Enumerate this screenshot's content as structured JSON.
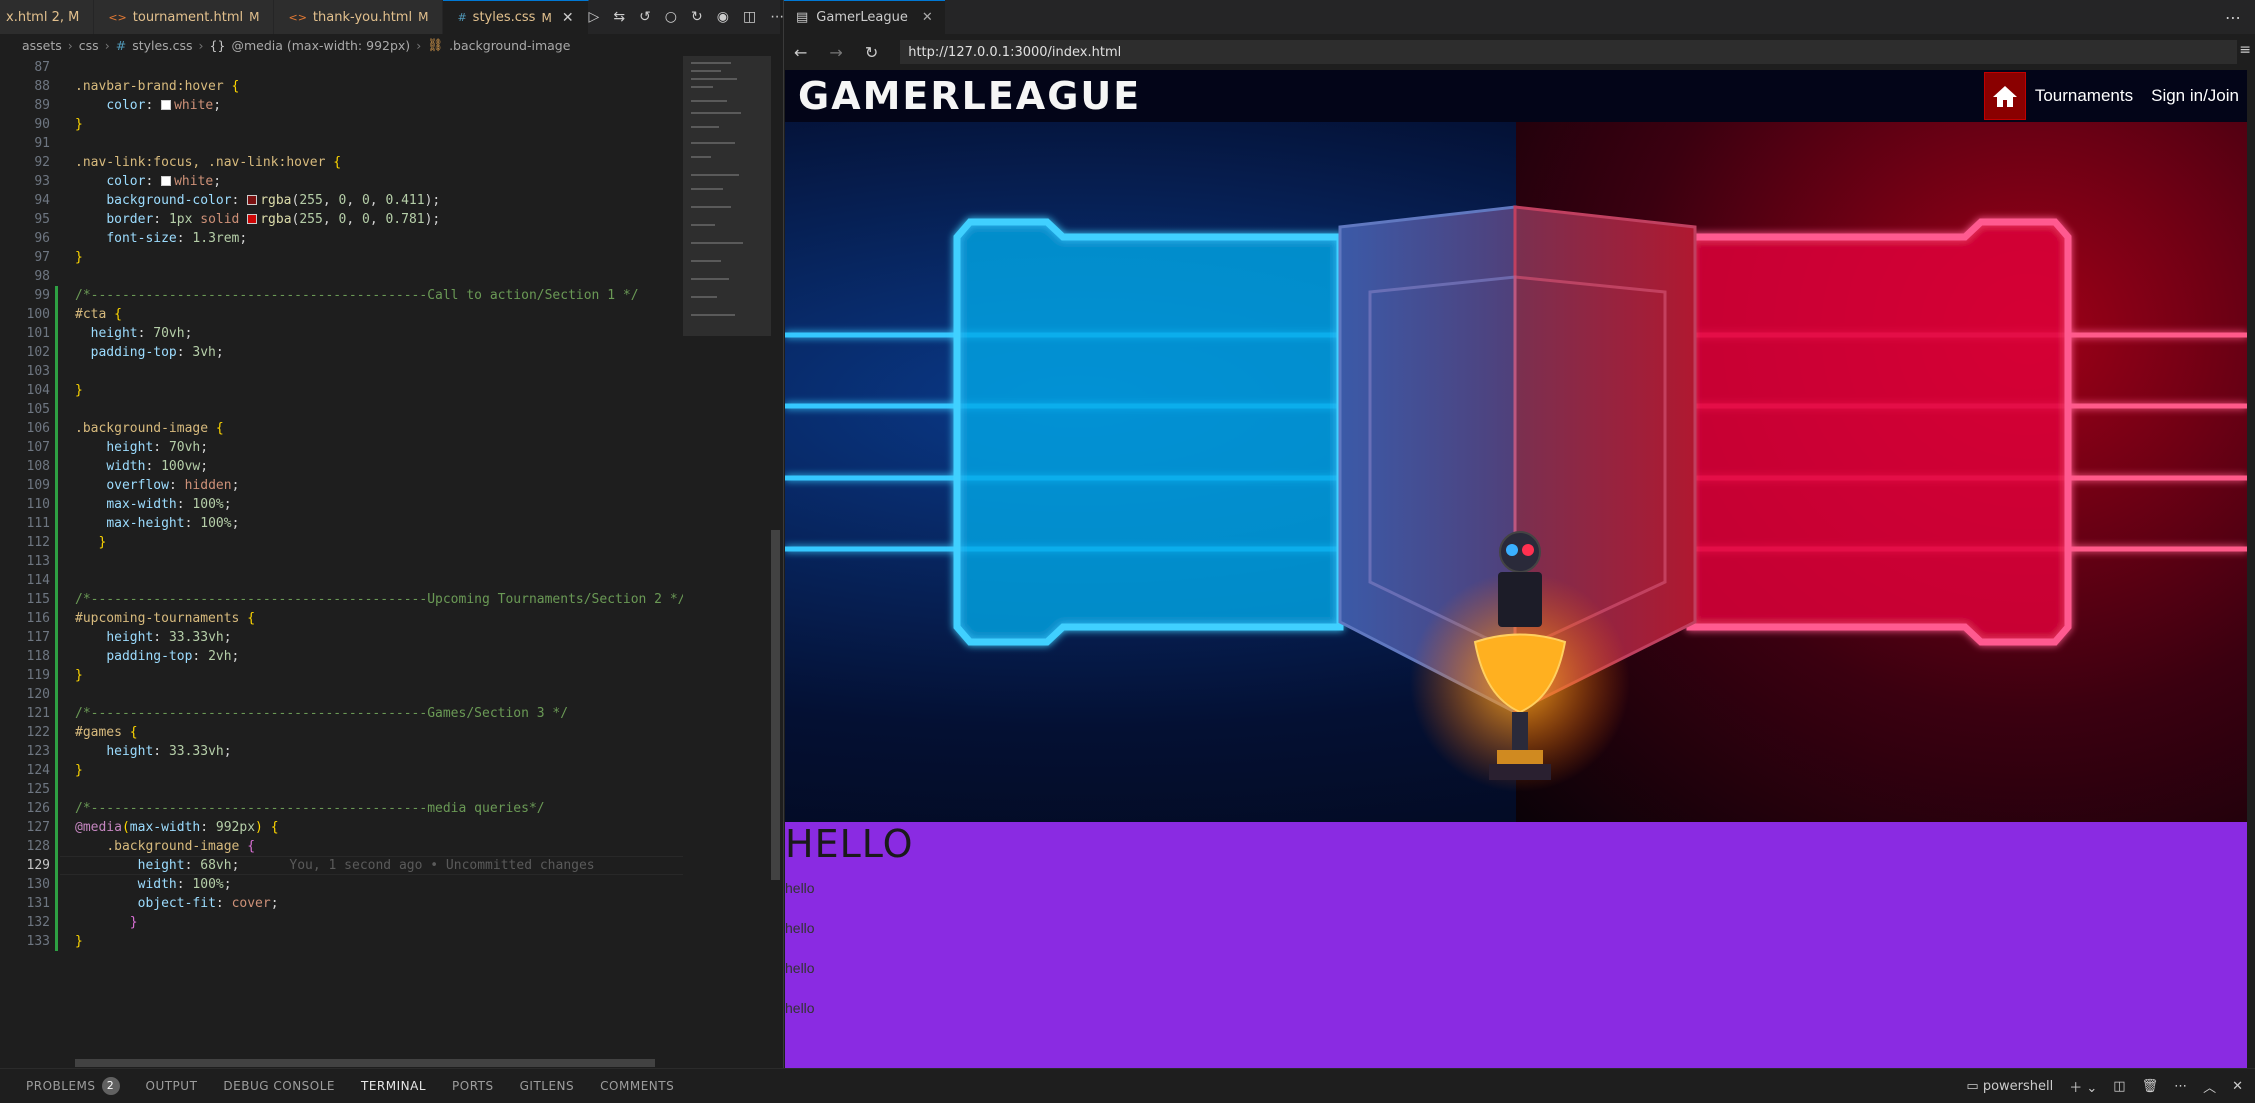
{
  "editor": {
    "tabs": [
      {
        "name": "x.html 2, M",
        "type": "html-partial"
      },
      {
        "name": "tournament.html",
        "status": "M",
        "type": "html"
      },
      {
        "name": "thank-you.html",
        "status": "M",
        "type": "html"
      },
      {
        "name": "styles.css",
        "status": "M",
        "type": "css",
        "active": true
      }
    ],
    "breadcrumb": [
      "assets",
      "css",
      "styles.css",
      "@media (max-width: 992px)",
      ".background-image"
    ],
    "current_line": 129,
    "blame": "You, 1 second ago • Uncommitted changes",
    "line_numbers": [
      "87",
      "88",
      "89",
      "90",
      "91",
      "92",
      "93",
      "94",
      "95",
      "96",
      "97",
      "98",
      "99",
      "100",
      "101",
      "102",
      "103",
      "104",
      "105",
      "106",
      "107",
      "108",
      "109",
      "110",
      "111",
      "112",
      "113",
      "114",
      "115",
      "116",
      "117",
      "118",
      "119",
      "120",
      "121",
      "122",
      "123",
      "124",
      "125",
      "126",
      "127",
      "128",
      "129",
      "130",
      "131",
      "132",
      "133"
    ]
  },
  "browser": {
    "tab_title": "GamerLeague",
    "url": "http://127.0.0.1:3000/index.html",
    "site": {
      "brand": "GAMERLEAGUE",
      "nav": [
        "Tournaments",
        "Sign in/Join"
      ],
      "heading": "HELLO",
      "lines": [
        "hello",
        "hello",
        "hello",
        "hello"
      ]
    }
  },
  "panel": {
    "tabs": [
      "PROBLEMS",
      "OUTPUT",
      "DEBUG CONSOLE",
      "TERMINAL",
      "PORTS",
      "GITLENS",
      "COMMENTS"
    ],
    "active_tab": "TERMINAL",
    "problems_count": "2",
    "terminal_shell": "powershell"
  },
  "colors": {
    "accent": "#0078d4",
    "navbar_bg": "#030518",
    "home_btn": "#8a0000",
    "section_purple": "#8a2be2"
  }
}
